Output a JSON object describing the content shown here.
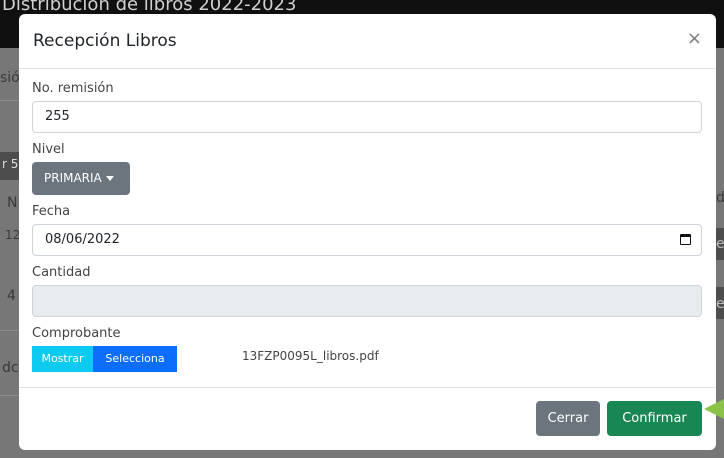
{
  "background": {
    "topbar_text": "Distribución de libros 2022-2023",
    "fragments": [
      "sió",
      "r 5",
      "N",
      "12",
      "4",
      "dc",
      "d",
      "e",
      "e"
    ]
  },
  "modal": {
    "title": "Recepción Libros",
    "close_glyph": "×",
    "fields": {
      "remision": {
        "label": "No. remisión",
        "value": "255"
      },
      "nivel": {
        "label": "Nivel",
        "selected": "PRIMARIA"
      },
      "fecha": {
        "label": "Fecha",
        "value": "08/06/2022"
      },
      "cantidad": {
        "label": "Cantidad",
        "value": ""
      },
      "comprobante": {
        "label": "Comprobante",
        "show_label": "Mostrar",
        "select_label": "Selecciona",
        "file_name": "13FZP0095L_libros.pdf"
      }
    },
    "footer": {
      "cancel_label": "Cerrar",
      "confirm_label": "Confirmar"
    }
  },
  "colors": {
    "secondary": "#6c757d",
    "success": "#198754",
    "info": "#0dcaf0",
    "primary": "#0d6efd",
    "hint_arrow": "#8bc34a"
  },
  "icons": [
    "close-icon",
    "calendar-icon",
    "caret-down-icon",
    "pointer-arrow-icon"
  ]
}
